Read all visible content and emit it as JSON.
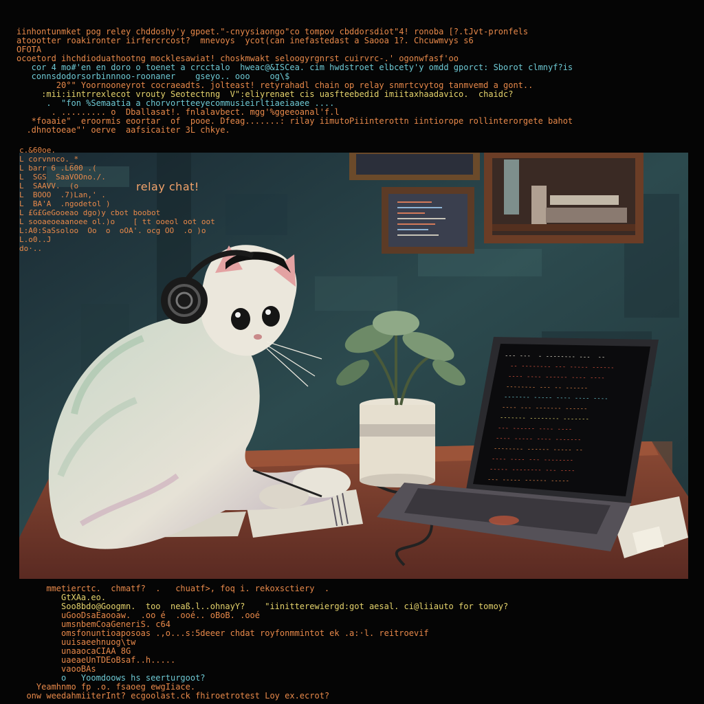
{
  "terminal_top": [
    {
      "text": "iinhontunmket pog reley chddoshy'y gpoet.\"-cnyysiaongo\"co tompov cbddorsdiot\"4! ronoba [?.tJvt-pronfels",
      "color": "orange"
    },
    {
      "text": "atoootter roakironter iirfercrcost?  mnevoys  ycot(can inefastedast a Saooa 1?. Chcuwmvys s6",
      "color": "orange"
    },
    {
      "text": "OFOTA",
      "color": "orange"
    },
    {
      "text": "ocoetord ihchdioduathootng mocklesawiat! choskmwakt seloogyrgnrst cuirvrc-.' ogonwfasf'oo",
      "color": "orange"
    },
    {
      "text": "   cor 4 mo#'en en doro o toenet a crcctalo  hweac@&ISCea. cim hwdstroet elbcety'y omdd gporct: Sborot clmnyf?is",
      "color": "cyan"
    },
    {
      "text": "   connsdodorsorbinnnoo-roonaner    gseyo.. ooo    og\\$",
      "color": "cyan"
    },
    {
      "text": "        20°\" Yoornooneyrot cocraeadts. jolteast! retyrahadl chain op relay snmrtcvytog tanmvemd a gont..",
      "color": "orange"
    },
    {
      "text": "",
      "color": "orange"
    },
    {
      "text": "     :mii:iintrrexlecot vrouty Seotectnng  V\":eliyrenaet cis uasfteebedid imiitaxhaadavico.  chaidc?",
      "color": "yellow"
    },
    {
      "text": "      .  \"fon %Semaatia a chorvortteeyecommusieirltiaeiaaee ....",
      "color": "cyan"
    },
    {
      "text": "       . ......... o  Dballasat!. fnlalavbect. mgg'%ggeeoanal'f.l",
      "color": "orange"
    },
    {
      "text": "   *foaaie\"  eroormis eoortar  of  pooe. Dfeag.......: rilay iimutoPiiinterottn iintiorope rollinterorgete bahot",
      "color": "orange"
    },
    {
      "text": "  .dhnotoeae\"' oerve  aafsicaiter 3L chkye.",
      "color": "orange"
    }
  ],
  "terminal_left": [
    "c.&60oe.",
    "L corvnnco._*",
    "L barr 6 .L600 .(",
    "L  SGS  SaaVOOno./.",
    "L  SAAVV.  (o",
    "L  BOOO  .7)Lan,' .",
    "L  BA'A  .ngodetol )",
    "L £G£GeGooeao dgo)y cbot boobot",
    "L sooaeoeaanoee ol.)o    [ tt ooeol oot oot",
    "L:A0:SaSsoloo  Oo  o  oOA'. ocg OO  .o )o",
    "L.o0..J",
    "do·.."
  ],
  "relay_label": "relay chat!",
  "terminal_bottom": [
    {
      "text": "      mmetierctc.  chmatf?  .   chuatf>, foq i. rekoxsctiery  .",
      "color": "orange"
    },
    {
      "text": "         GtXAa.eo.",
      "color": "yellow"
    },
    {
      "text": "         Soo8bdo@Googmn.  too  neaß.l..ohnayY?    \"iinitterewiergd:got aesal. ci@liiauto for tomoy?",
      "color": "yellow"
    },
    {
      "text": "         uGooDsaEaooaw.  .oo é  .ooé.. oBoB. .ooé",
      "color": "orange"
    },
    {
      "text": "         umsnbemCoaGeneriS. c64",
      "color": "orange"
    },
    {
      "text": "         omsfonuntioaposoas .,o...s:5deeer chdat royfonmmintot ek .a:·l. reitroevif",
      "color": "orange"
    },
    {
      "text": "         uuisaeehnuog\\tw",
      "color": "orange"
    },
    {
      "text": "         unaaocaCIAA 8G",
      "color": "orange"
    },
    {
      "text": "         uaeaeUnTDEoBsaf..h.....",
      "color": "orange"
    },
    {
      "text": "         vaooBAs",
      "color": "orange"
    },
    {
      "text": "         o   Yoomdoows hs seerturgoot?",
      "color": "cyan"
    },
    {
      "text": "    Yeamhnmo fp .o. fsaoeg ewgIiace.",
      "color": "orange"
    },
    {
      "text": "  onw weedahmiiterInt? ecgoolast.ck fhiroetrotest Loy ex.ecrot?",
      "color": "orange"
    }
  ],
  "laptop_screen_lines": [
    {
      "text": "--- ---  - -------- ---  --",
      "color": "white"
    },
    {
      "text": "  -- -------- --- ----- ------",
      "color": "red"
    },
    {
      "text": "  ---- ---- ------ ---- ----",
      "color": "red"
    },
    {
      "text": "  -------- --- -- ------",
      "color": "orange"
    },
    {
      "text": "  ------- ----- ---- ---- ----",
      "color": "cyan"
    },
    {
      "text": "  ---- --- ------- ------",
      "color": "orange"
    },
    {
      "text": "  ------- -------- -------",
      "color": "yellow"
    },
    {
      "text": "  --- ------ ---- ----",
      "color": "red"
    },
    {
      "text": "  ---- ----- ---- -------",
      "color": "red"
    },
    {
      "text": "  -------- ------ ----- --",
      "color": "orange"
    },
    {
      "text": "  ---- ---- --- --------",
      "color": "red"
    },
    {
      "text": "  ----- -------- --- ----",
      "color": "red"
    },
    {
      "text": "  --- ----- ------ -----",
      "color": "orange"
    }
  ],
  "palette": {
    "wall_teal": "#2c4a4e",
    "wall_dark": "#1c2a30",
    "desk_brown": "#7a3f2e",
    "cat_fur": "#e4e2d6",
    "laptop_screen": "#0b0b0d",
    "terminal_orange": "#e8894a"
  }
}
